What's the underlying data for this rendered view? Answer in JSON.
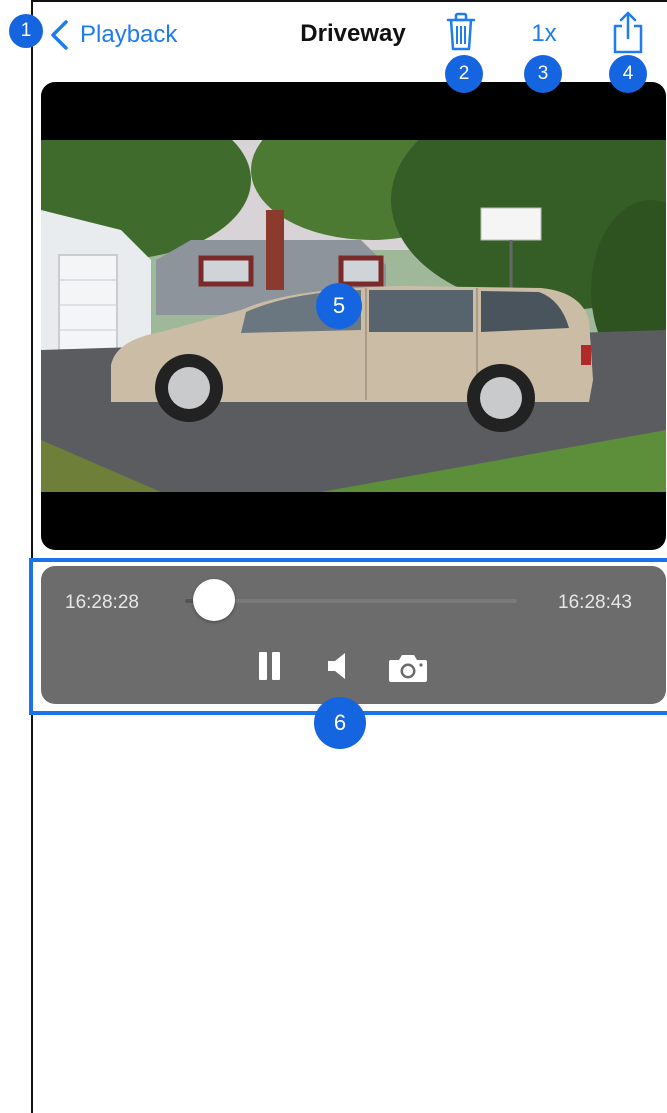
{
  "nav": {
    "back_label": "Playback",
    "title": "Driveway",
    "speed_label": "1x"
  },
  "badges": {
    "b1": "1",
    "b2": "2",
    "b3": "3",
    "b4": "4",
    "b5": "5",
    "b6": "6"
  },
  "video": {
    "scene": "Driveway camera frame: silver minivan parked in a driveway"
  },
  "controls": {
    "time_start": "16:28:28",
    "time_end": "16:28:43",
    "progress": 0.08
  },
  "icons": {
    "back": "chevron-left-icon",
    "delete": "trash-icon",
    "share": "share-icon",
    "pause": "pause-icon",
    "volume": "speaker-icon",
    "snapshot": "camera-icon"
  },
  "colors": {
    "accent": "#1e7bf0",
    "badge": "#1565e0",
    "highlight": "#1a73e8",
    "controls_bg": "#6c6c6c"
  }
}
